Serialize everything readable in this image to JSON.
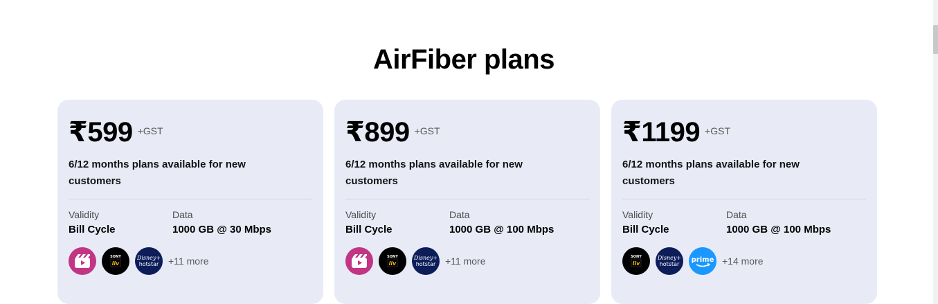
{
  "section": {
    "title": "AirFiber plans"
  },
  "plans": [
    {
      "price": "₹599",
      "tax": "+GST",
      "description": "6/12 months plans available for new customers",
      "validity_label": "Validity",
      "validity_value": "Bill Cycle",
      "data_label": "Data",
      "data_value": "1000 GB @ 30 Mbps",
      "ott_icons": [
        "jiocinema-icon",
        "sonyliv-icon",
        "disney-hotstar-icon"
      ],
      "more": "+11 more"
    },
    {
      "price": "₹899",
      "tax": "+GST",
      "description": "6/12 months plans available for new customers",
      "validity_label": "Validity",
      "validity_value": "Bill Cycle",
      "data_label": "Data",
      "data_value": "1000 GB @ 100 Mbps",
      "ott_icons": [
        "jiocinema-icon",
        "sonyliv-icon",
        "disney-hotstar-icon"
      ],
      "more": "+11 more"
    },
    {
      "price": "₹1199",
      "tax": "+GST",
      "description": "6/12 months plans available for new customers",
      "validity_label": "Validity",
      "validity_value": "Bill Cycle",
      "data_label": "Data",
      "data_value": "1000 GB @ 100 Mbps",
      "ott_icons": [
        "sonyliv-icon",
        "disney-hotstar-icon",
        "prime-video-icon"
      ],
      "more": "+14 more"
    }
  ],
  "colors": {
    "card_bg": "#e8ebf6",
    "jiocinema": "#c13584",
    "sonyliv": "#000000",
    "hotstar": "#0c1d5a",
    "prime": "#1a98ff"
  }
}
